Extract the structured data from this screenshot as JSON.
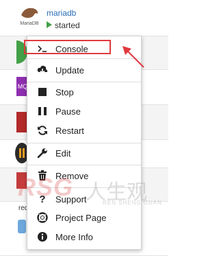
{
  "app": {
    "name": "mariadb",
    "logo_text": "MariaDB",
    "status": "started"
  },
  "background_fragments": {
    "mq_logo_text": "MQ",
    "snippet_text": "red"
  },
  "menu": {
    "items": [
      {
        "key": "console",
        "label": "Console",
        "icon": "terminal-icon"
      },
      {
        "key": "update",
        "label": "Update",
        "icon": "download-icon"
      },
      {
        "key": "stop",
        "label": "Stop",
        "icon": "stop-icon"
      },
      {
        "key": "pause",
        "label": "Pause",
        "icon": "pause-icon"
      },
      {
        "key": "restart",
        "label": "Restart",
        "icon": "restart-icon"
      },
      {
        "key": "edit",
        "label": "Edit",
        "icon": "wrench-icon"
      },
      {
        "key": "remove",
        "label": "Remove",
        "icon": "trash-icon"
      },
      {
        "key": "support",
        "label": "Support",
        "icon": "question-icon"
      },
      {
        "key": "project_page",
        "label": "Project Page",
        "icon": "lifebuoy-icon"
      },
      {
        "key": "more_info",
        "label": "More Info",
        "icon": "info-icon"
      }
    ]
  },
  "watermark": {
    "brand": "RSG",
    "chinese": "人生观",
    "pinyin": "REN SHENG GUAN"
  },
  "colors": {
    "highlight": "#e0393e",
    "accent_link": "#2a6fb7",
    "status_green": "#43a047"
  }
}
